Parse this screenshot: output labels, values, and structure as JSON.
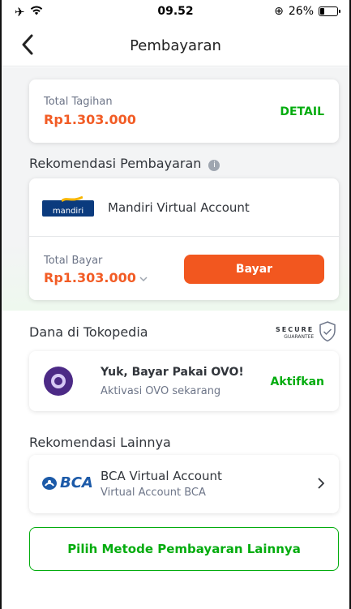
{
  "status_bar": {
    "time": "09.52",
    "battery": "26%",
    "battery_level": 0.26
  },
  "header": {
    "title": "Pembayaran"
  },
  "total_tagihan": {
    "label": "Total Tagihan",
    "amount": "Rp1.303.000",
    "detail_label": "DETAIL"
  },
  "rekomendasi": {
    "title": "Rekomendasi Pembayaran",
    "method": {
      "logo_text": "mandiri",
      "name": "Mandiri Virtual Account"
    },
    "total_bayar_label": "Total Bayar",
    "total_bayar_amount": "Rp1.303.000",
    "pay_button": "Bayar"
  },
  "dana": {
    "title": "Dana di Tokopedia",
    "secure_line1": "SECURE",
    "secure_line2": "GUARANTEE",
    "ovo": {
      "headline": "Yuk, Bayar Pakai OVO!",
      "sub": "Aktivasi OVO sekarang",
      "action": "Aktifkan"
    }
  },
  "lainnya": {
    "title": "Rekomendasi Lainnya",
    "method": {
      "logo_text": "BCA",
      "name": "BCA Virtual Account",
      "sub": "Virtual Account BCA"
    }
  },
  "footer_button": "Pilih Metode Pembayaran Lainnya",
  "colors": {
    "green": "#03ac0e",
    "orange": "#f2571f",
    "price_red": "#f94d63"
  }
}
